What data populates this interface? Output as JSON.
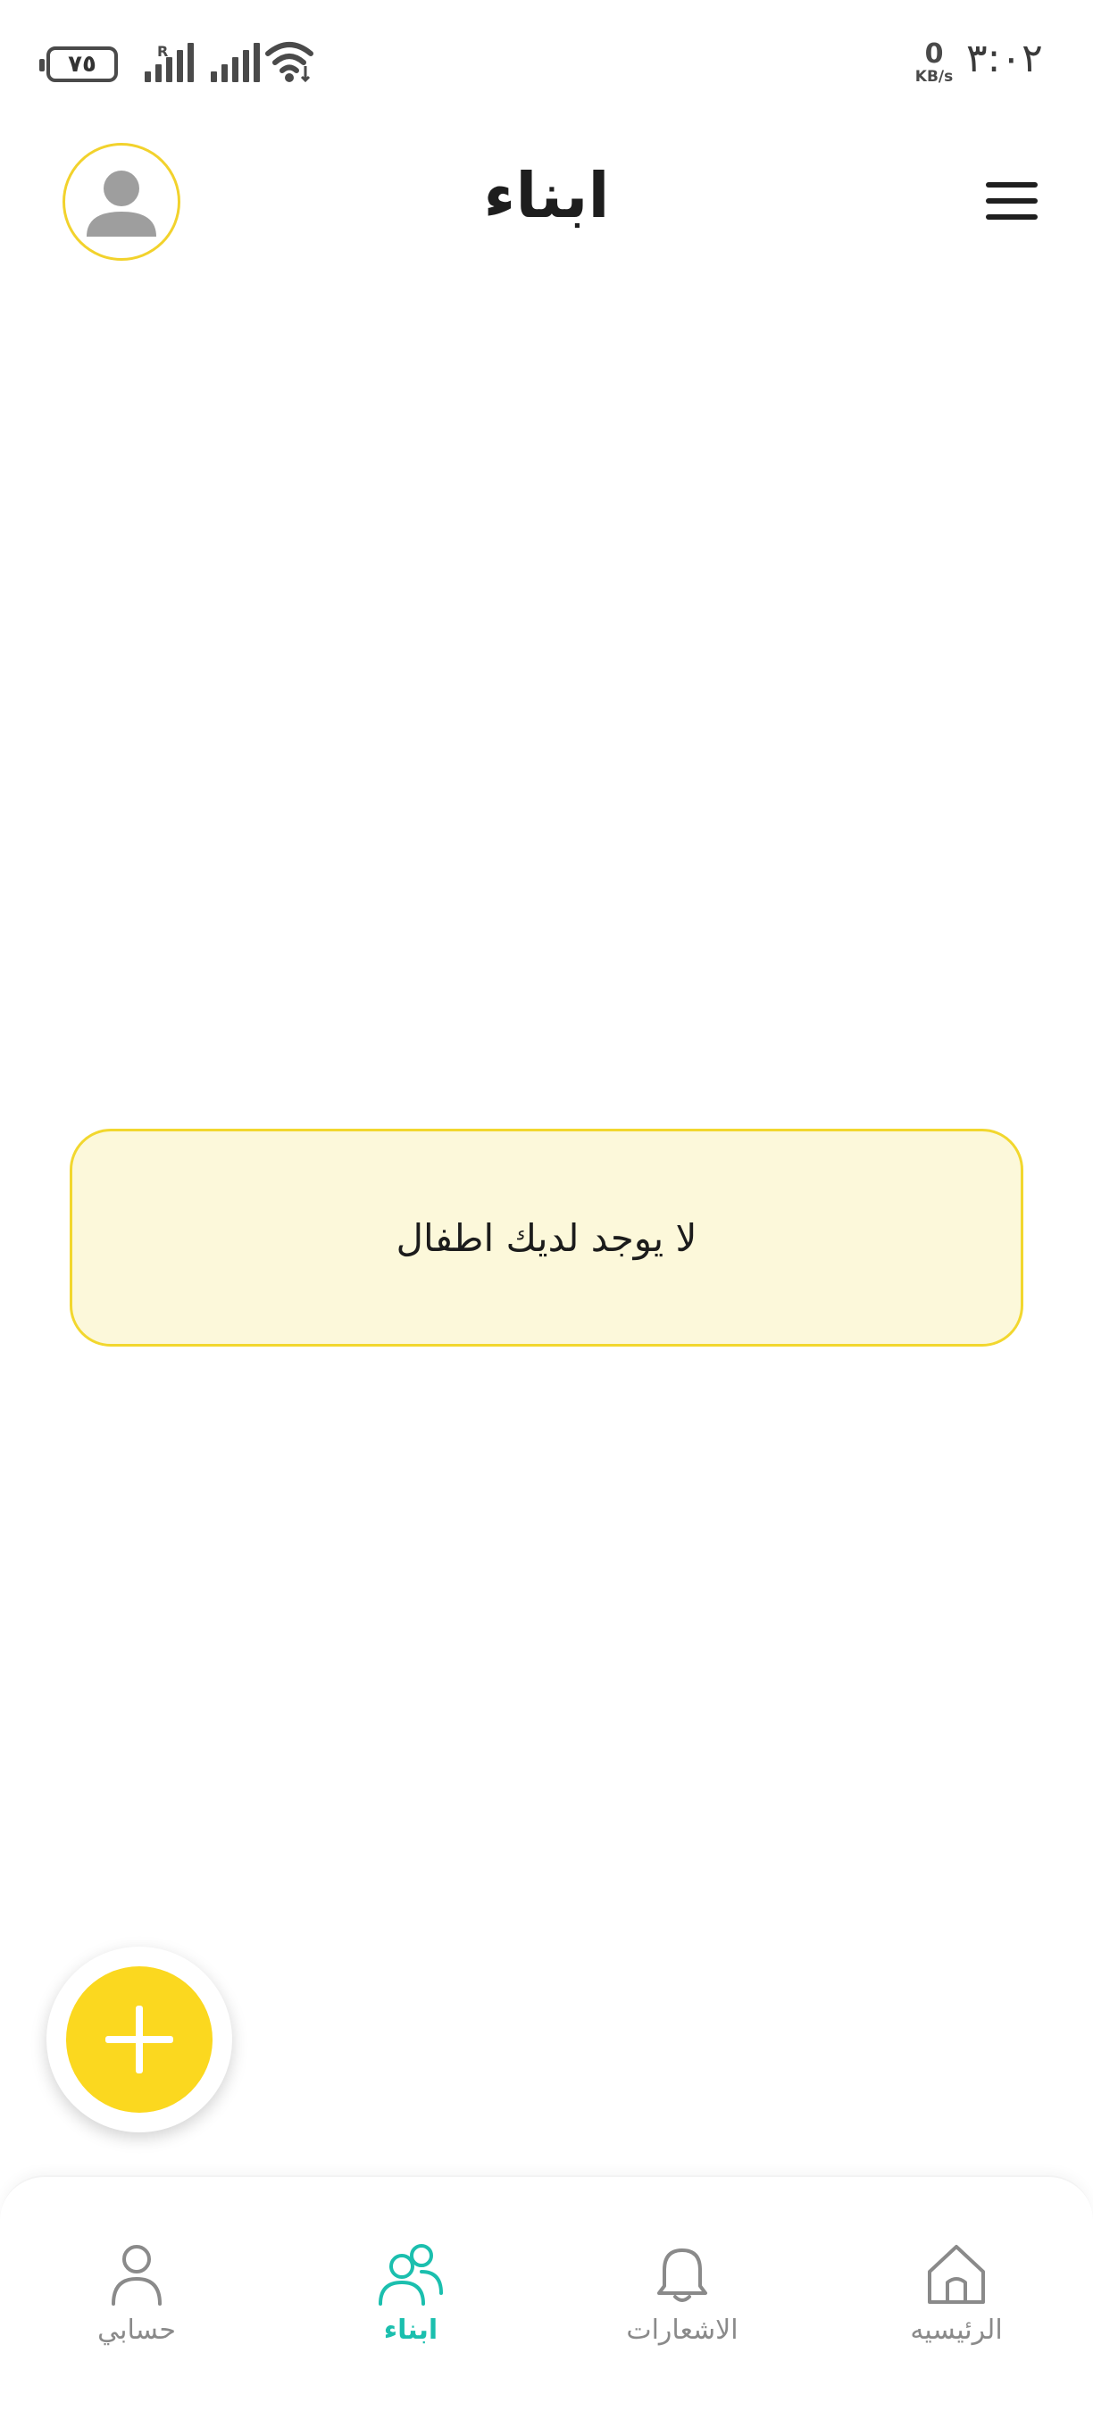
{
  "status_bar": {
    "battery": "٧٥",
    "net_speed_value": "0",
    "net_speed_unit": "KB/s",
    "time": "٣:٠٢",
    "roaming": "R"
  },
  "header": {
    "title": "ابناء",
    "avatar_icon": "person-icon",
    "menu_icon": "hamburger-menu-icon"
  },
  "empty_state": {
    "message": "لا يوجد لديك اطفال"
  },
  "fab": {
    "icon": "plus-icon"
  },
  "bottom_nav": {
    "items": [
      {
        "id": "account",
        "label": "حسابي",
        "icon": "person-icon",
        "active": false
      },
      {
        "id": "kids",
        "label": "ابناء",
        "icon": "people-icon",
        "active": true
      },
      {
        "id": "notifications",
        "label": "الاشعارات",
        "icon": "bell-icon",
        "active": false
      },
      {
        "id": "home",
        "label": "الرئيسيه",
        "icon": "home-icon",
        "active": false
      }
    ]
  },
  "colors": {
    "accent_yellow": "#fbd81f",
    "empty_bg": "#fcf8da",
    "active_teal": "#1bbfae",
    "inactive_gray": "#8a8a8a"
  }
}
